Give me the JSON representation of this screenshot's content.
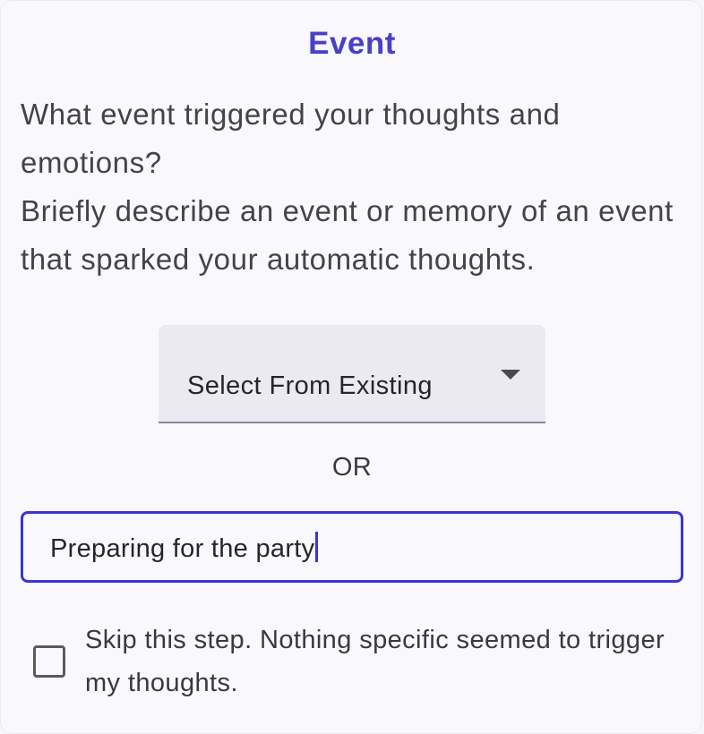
{
  "step": {
    "title": "Event",
    "question_line1": "What event triggered your thoughts and emotions?",
    "question_line2": "Briefly describe an event or memory of an event that sparked your automatic thoughts."
  },
  "select": {
    "label": "Select From Existing",
    "icon": "chevron-down-icon"
  },
  "separator": "OR",
  "event_input": {
    "value": "Preparing for the party"
  },
  "skip": {
    "checked": false,
    "label": "Skip this step. Nothing specific seemed to trigger my thoughts."
  },
  "colors": {
    "accent": "#4a40c8",
    "focus_border": "#3b33d6",
    "background": "#f9f8fd"
  }
}
